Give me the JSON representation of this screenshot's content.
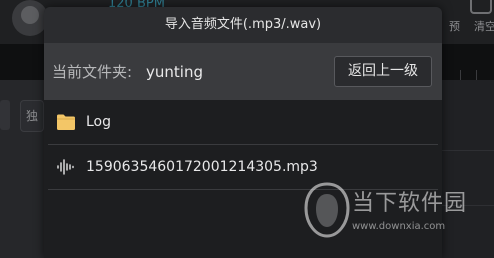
{
  "background": {
    "bpm_text": "120 BPM",
    "right_label_1": "预",
    "right_label_2": "清空",
    "left_button_label": "独"
  },
  "dialog": {
    "title": "导入音频文件(.mp3/.wav)",
    "path_label": "当前文件夹:",
    "path_value": "yunting",
    "up_button_label": "返回上一级",
    "items": [
      {
        "type": "folder",
        "icon": "folder-icon",
        "label": "Log"
      },
      {
        "type": "audio",
        "icon": "audio-waveform-icon",
        "label": "1590635460172001214305.mp3"
      }
    ]
  },
  "watermark": {
    "brand": "当下软件园",
    "url": "www.downxia.com"
  },
  "colors": {
    "dialog_bg": "#1d1e20",
    "title_bar_bg": "#2b2c2f",
    "path_bar_bg": "#3a3b3e",
    "folder_icon": "#f3c667",
    "bpm_accent": "#2f7f93"
  }
}
